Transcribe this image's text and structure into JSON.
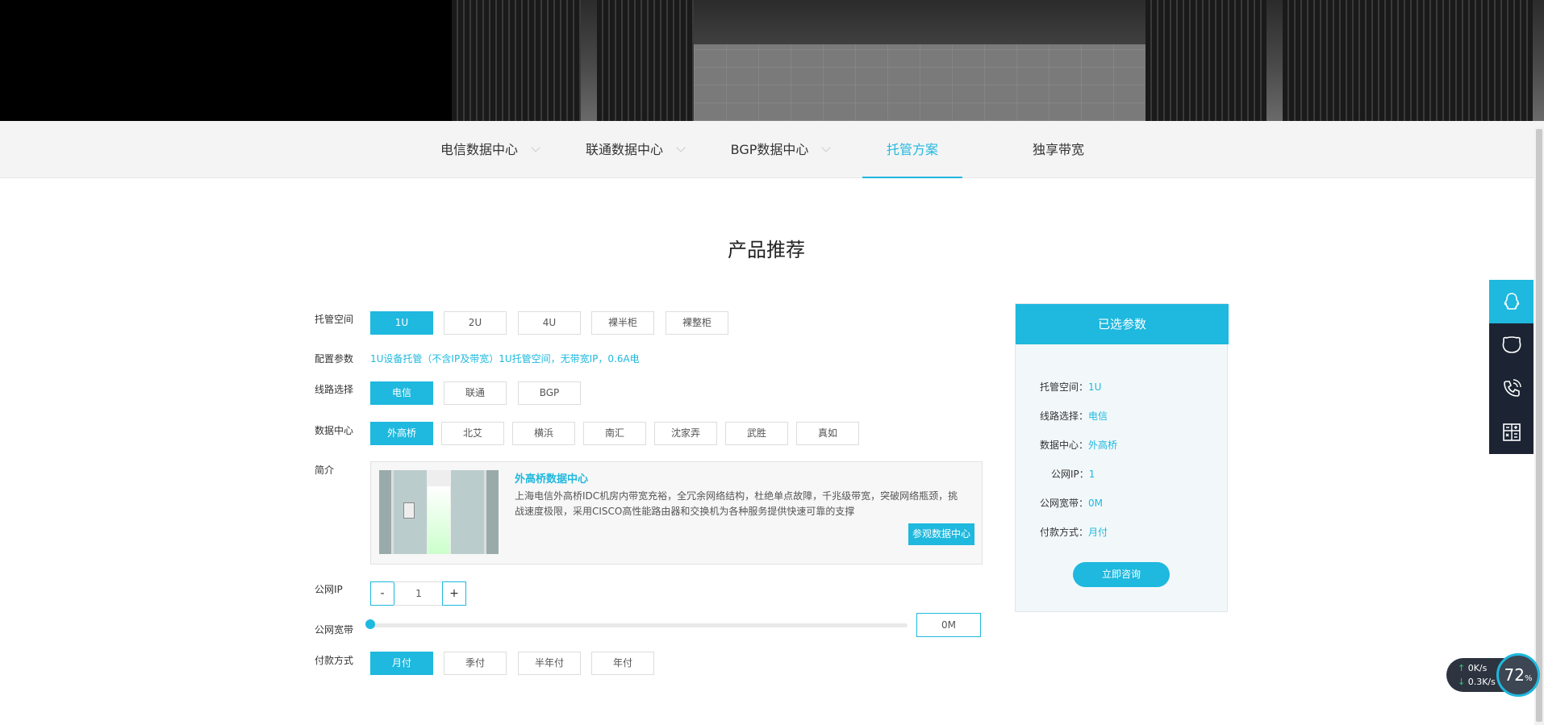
{
  "tabs": [
    {
      "label": "电信数据中心",
      "has_dropdown": true,
      "active": false
    },
    {
      "label": "联通数据中心",
      "has_dropdown": true,
      "active": false
    },
    {
      "label": "BGP数据中心",
      "has_dropdown": true,
      "active": false
    },
    {
      "label": "托管方案",
      "has_dropdown": false,
      "active": true
    },
    {
      "label": "独享带宽",
      "has_dropdown": false,
      "active": false
    }
  ],
  "section_title": "产品推荐",
  "form": {
    "space": {
      "label": "托管空间",
      "options": [
        "1U",
        "2U",
        "4U",
        "裸半柜",
        "裸整柜"
      ],
      "selected": "1U"
    },
    "config": {
      "label": "配置参数",
      "text": "1U设备托管（不含IP及带宽）1U托管空间，无带宽IP，0.6A电"
    },
    "line": {
      "label": "线路选择",
      "options": [
        "电信",
        "联通",
        "BGP"
      ],
      "selected": "电信"
    },
    "dc": {
      "label": "数据中心",
      "options": [
        "外高桥",
        "北艾",
        "横浜",
        "南汇",
        "沈家弄",
        "武胜",
        "真如"
      ],
      "selected": "外高桥"
    },
    "intro": {
      "label": "简介",
      "title": "外高桥数据中心",
      "desc": "上海电信外高桥IDC机房内带宽充裕，全冗余网络结构，杜绝单点故障，千兆级带宽，突破网络瓶颈，挑战速度极限，采用CISCO高性能路由器和交换机为各种服务提供快速可靠的支撑",
      "button": "参观数据中心"
    },
    "ip": {
      "label": "公网IP",
      "minus": "-",
      "value": "1",
      "plus": "+"
    },
    "bandwidth": {
      "label": "公网宽带",
      "value": "0M",
      "slider_fraction": 0
    },
    "pay": {
      "label": "付款方式",
      "options": [
        "月付",
        "季付",
        "半年付",
        "年付"
      ],
      "selected": "月付"
    }
  },
  "panel": {
    "title": "已选参数",
    "rows": [
      {
        "key": "托管空间：",
        "val": "1U"
      },
      {
        "key": "线路选择：",
        "val": "电信"
      },
      {
        "key": "数据中心：",
        "val": "外高桥"
      },
      {
        "key": "公网IP：",
        "val": "1"
      },
      {
        "key": "公网宽带：",
        "val": "0M"
      },
      {
        "key": "付款方式：",
        "val": "月付"
      }
    ],
    "button": "立即咨询"
  },
  "float_bar": {
    "icons": [
      "qq-icon",
      "wechat-icon",
      "phone-icon",
      "calculator-icon"
    ]
  },
  "network_widget": {
    "up": "0",
    "up_unit": "K/s",
    "down": "0.3",
    "down_unit": "K/s",
    "percent": "72",
    "percent_unit": "%"
  },
  "colors": {
    "accent": "#1fb8de",
    "dark_bar": "#1c2433"
  }
}
